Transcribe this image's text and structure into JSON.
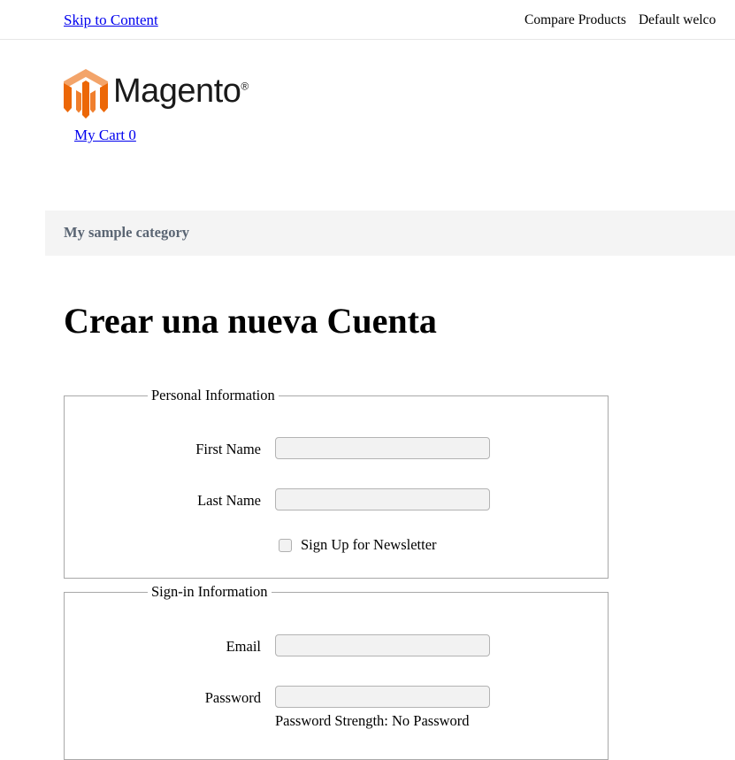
{
  "topbar": {
    "skip_link": "Skip to Content",
    "compare_products": "Compare Products",
    "welcome_message": "Default welco"
  },
  "branding": {
    "logo_word": "Magento",
    "logo_registered": "®",
    "cart_link": "My Cart 0",
    "colors": {
      "orange_dark": "#ec6707",
      "orange_mid": "#f07f2d",
      "orange_light": "#f3a46a",
      "wordmark": "#1a1a1a"
    }
  },
  "category_nav": {
    "items": [
      {
        "label": "My sample category"
      }
    ],
    "background": "#f4f4f4",
    "text_color": "#5a6573"
  },
  "page": {
    "title": "Crear una nueva Cuenta"
  },
  "form": {
    "personal": {
      "legend": "Personal Information",
      "first_name": {
        "label": "First Name",
        "value": "",
        "placeholder": ""
      },
      "last_name": {
        "label": "Last Name",
        "value": "",
        "placeholder": ""
      },
      "newsletter": {
        "label": "Sign Up for Newsletter",
        "checked": false
      }
    },
    "signin": {
      "legend": "Sign-in Information",
      "email": {
        "label": "Email",
        "value": "",
        "placeholder": ""
      },
      "password": {
        "label": "Password",
        "value": "",
        "placeholder": ""
      },
      "password_strength": "Password Strength: No Password"
    }
  }
}
